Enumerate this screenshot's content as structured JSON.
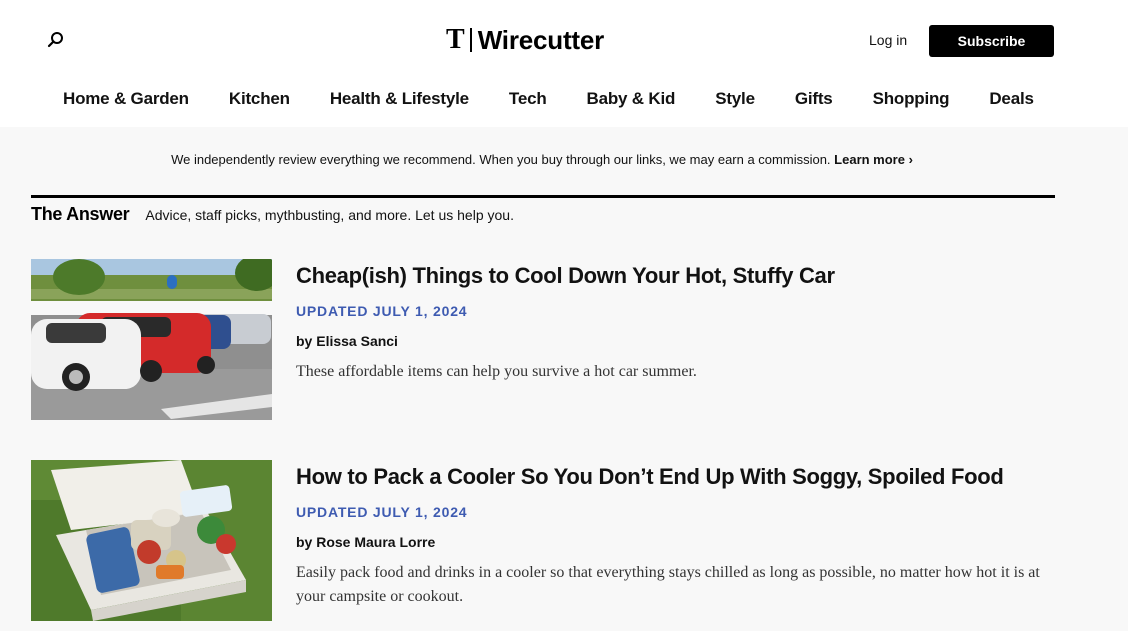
{
  "header": {
    "logo_mark": "T",
    "logo_text": "Wirecutter",
    "login_label": "Log in",
    "subscribe_label": "Subscribe"
  },
  "nav": [
    {
      "label": "Home & Garden"
    },
    {
      "label": "Kitchen"
    },
    {
      "label": "Health & Lifestyle"
    },
    {
      "label": "Tech"
    },
    {
      "label": "Baby & Kid"
    },
    {
      "label": "Style"
    },
    {
      "label": "Gifts"
    },
    {
      "label": "Shopping"
    },
    {
      "label": "Deals"
    }
  ],
  "disclosure": {
    "text": "We independently review everything we recommend. When you buy through our links, we may earn a commission.",
    "link_label": "Learn more ›"
  },
  "section": {
    "title": "The Answer",
    "description": "Advice, staff picks, mythbusting, and more. Let us help you."
  },
  "articles": [
    {
      "title": "Cheap(ish) Things to Cool Down Your Hot, Stuffy Car",
      "date": "UPDATED JULY 1, 2024",
      "author_prefix": "by",
      "author": "Elissa Sanci",
      "description": "These affordable items can help you survive a hot car summer."
    },
    {
      "title": "How to Pack a Cooler So You Don’t End Up With Soggy, Spoiled Food",
      "date": "UPDATED JULY 1, 2024",
      "author_prefix": "by",
      "author": "Rose Maura Lorre",
      "description": "Easily pack food and drinks in a cooler so that everything stays chilled as long as possible, no matter how hot it is at your campsite or cookout."
    }
  ],
  "colors": {
    "accent_date": "#3e5bb1",
    "page_bg": "#f8f8f8",
    "header_bg": "#ffffff"
  }
}
